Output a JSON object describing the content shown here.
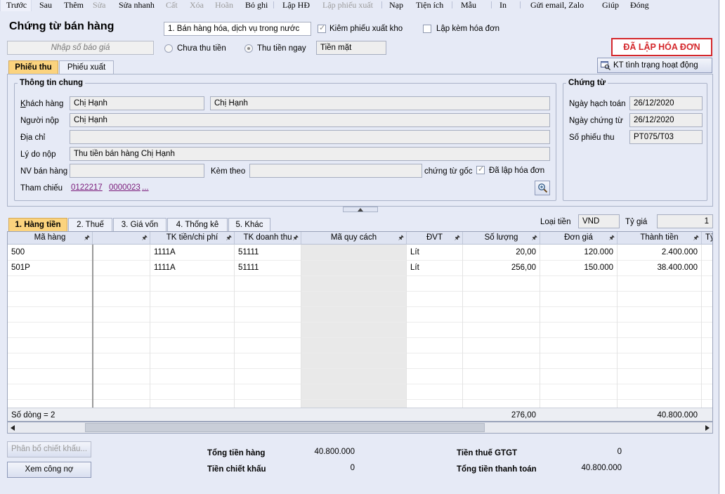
{
  "toolbar": {
    "items": [
      {
        "label": "Trước",
        "enabled": true
      },
      {
        "label": "Sau",
        "enabled": true
      },
      {
        "label": "Thêm",
        "enabled": true
      },
      {
        "label": "Sửa",
        "enabled": false
      },
      {
        "label": "Sửa nhanh",
        "enabled": true
      },
      {
        "label": "Cất",
        "enabled": false
      },
      {
        "label": "Xóa",
        "enabled": false
      },
      {
        "label": "Hoãn",
        "enabled": false
      },
      {
        "label": "Bỏ ghi",
        "enabled": true
      },
      {
        "label": "Lập HĐ",
        "enabled": true
      },
      {
        "label": "Lập phiếu xuất",
        "enabled": false
      },
      {
        "label": "Nạp",
        "enabled": true
      },
      {
        "label": "Tiện ích",
        "enabled": true
      },
      {
        "label": "Mẫu",
        "enabled": true
      },
      {
        "label": "In",
        "enabled": true
      },
      {
        "label": "Gửi email, Zalo",
        "enabled": true
      },
      {
        "label": "Giúp",
        "enabled": true
      },
      {
        "label": "Đóng",
        "enabled": true
      }
    ]
  },
  "header": {
    "title": "Chứng từ bán hàng",
    "sale_type": "1. Bán hàng hóa, dịch vụ trong nước",
    "quote_placeholder": "Nhập số báo giá",
    "kiem_phieu_xuat_kho": "Kiêm phiếu xuất kho",
    "lap_kem_hoa_don": "Lập kèm hóa đơn",
    "chua_thu_tien": "Chưa thu tiền",
    "thu_tien_ngay": "Thu tiền ngay",
    "payment_method": "Tiền mặt",
    "status_badge": "ĐÃ LẬP HÓA ĐƠN",
    "status_color": "#d4272b"
  },
  "tabs": {
    "phieu_thu": "Phiếu thu",
    "phieu_xuat": "Phiếu xuất",
    "kt_button": "KT tình trạng hoạt động DN"
  },
  "general": {
    "legend": "Thông tin chung",
    "khach_hang_label": "Khách hàng",
    "khach_hang_code": "Chị Hạnh",
    "khach_hang_name": "Chị Hạnh",
    "nguoi_nop_label": "Người nộp",
    "nguoi_nop": "Chị Hạnh",
    "dia_chi_label": "Địa chỉ",
    "dia_chi": "",
    "ly_do_label": "Lý do nộp",
    "ly_do": "Thu tiền bán hàng Chị Hạnh",
    "nv_label": "NV bán hàng",
    "nv": "",
    "kem_theo_label": "Kèm theo",
    "kem_theo": "",
    "chung_tu_goc": "chứng từ gốc",
    "da_lap_hoa_don": "Đã lập hóa đơn",
    "tham_chieu_label": "Tham chiếu",
    "ref1": "0122217",
    "ref2": "0000023",
    "ref_more": "..."
  },
  "voucher": {
    "legend": "Chứng từ",
    "ngay_hach_toan_label": "Ngày hạch toán",
    "ngay_hach_toan": "26/12/2020",
    "ngay_chung_tu_label": "Ngày chứng từ",
    "ngay_chung_tu": "26/12/2020",
    "so_phieu_thu_label": "Số phiếu thu",
    "so_phieu_thu": "PT075/T03"
  },
  "detail_tabs": [
    "1. Hàng tiền",
    "2. Thuế",
    "3. Giá vốn",
    "4. Thống kê",
    "5. Khác"
  ],
  "currency": {
    "loai_tien_label": "Loại tiền",
    "loai_tien": "VND",
    "ty_gia_label": "Tỷ giá",
    "ty_gia": "1"
  },
  "grid": {
    "columns": [
      "Mã hàng",
      "",
      "TK tiền/chi phí",
      "TK doanh thu",
      "Mã quy cách",
      "ĐVT",
      "Số lượng",
      "Đơn giá",
      "Thành tiền",
      "Tỷ"
    ],
    "rows": [
      [
        "500",
        "",
        "1111A",
        "51111",
        "",
        "Lít",
        "20,00",
        "120.000",
        "2.400.000"
      ],
      [
        "501P",
        "",
        "1111A",
        "51111",
        "",
        "Lít",
        "256,00",
        "150.000",
        "38.400.000"
      ]
    ],
    "row_count": "Số dòng = 2",
    "total_qty": "276,00",
    "total_amount": "40.800.000"
  },
  "summary": {
    "phan_bo_btn": "Phân bổ chiết khấu...",
    "xem_cong_no_btn": "Xem công nợ",
    "tong_tien_hang_label": "Tổng tiền hàng",
    "tong_tien_hang": "40.800.000",
    "tien_chiet_khau_label": "Tiền chiết khấu",
    "tien_chiet_khau": "0",
    "tien_thue_label": "Tiền thuế GTGT",
    "tien_thue": "0",
    "tong_thanh_toan_label": "Tổng tiền thanh toán",
    "tong_thanh_toan": "40.800.000"
  }
}
